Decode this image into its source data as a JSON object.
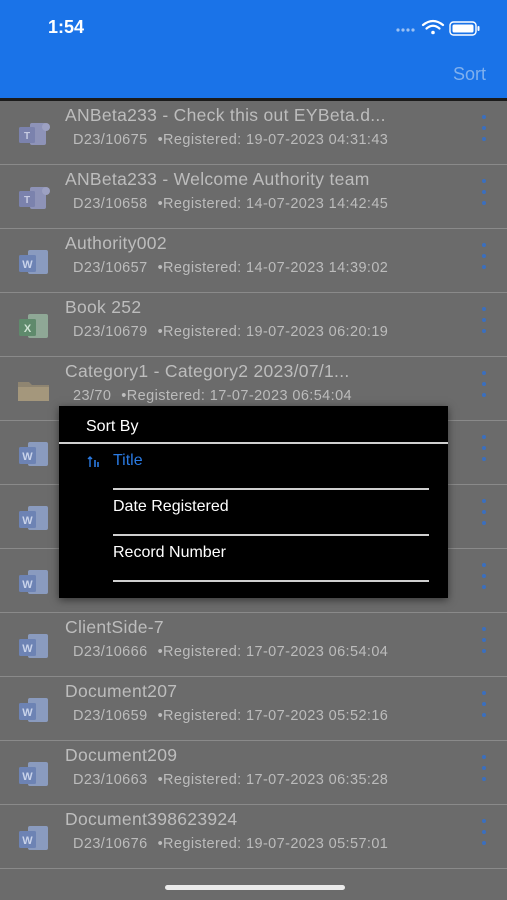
{
  "status": {
    "time": "1:54"
  },
  "nav": {
    "sort_label": "Sort"
  },
  "records": [
    {
      "title": "ANBeta233 - Check this out  EYBeta.d...",
      "number": "D23/10675",
      "registered": "•Registered:  19-07-2023 04:31:43",
      "icon": "teams-icon"
    },
    {
      "title": "ANBeta233 - Welcome Authority team",
      "number": "D23/10658",
      "registered": "•Registered:  14-07-2023 14:42:45",
      "icon": "teams-icon"
    },
    {
      "title": "Authority002",
      "number": "D23/10657",
      "registered": "•Registered:  14-07-2023 14:39:02",
      "icon": "word-icon"
    },
    {
      "title": "Book 252",
      "number": "D23/10679",
      "registered": "•Registered:  19-07-2023 06:20:19",
      "icon": "excel-icon"
    },
    {
      "title": "Category1 - Category2 2023/07/1...",
      "number": "23/70",
      "registered": "•Registered:  17-07-2023 06:54:04",
      "icon": "folder-icon"
    },
    {
      "title": "",
      "number": "",
      "registered": "",
      "icon": "word-icon"
    },
    {
      "title": "",
      "number": "",
      "registered": "",
      "icon": "word-icon"
    },
    {
      "title": "",
      "number": "",
      "registered": "",
      "icon": "word-icon"
    },
    {
      "title": "ClientSide-7",
      "number": "D23/10666",
      "registered": "•Registered:  17-07-2023 06:54:04",
      "icon": "word-icon"
    },
    {
      "title": "Document207",
      "number": "D23/10659",
      "registered": "•Registered:  17-07-2023 05:52:16",
      "icon": "word-icon"
    },
    {
      "title": "Document209",
      "number": "D23/10663",
      "registered": "•Registered:  17-07-2023 06:35:28",
      "icon": "word-icon"
    },
    {
      "title": "Document398623924",
      "number": "D23/10676",
      "registered": "•Registered:  19-07-2023 05:57:01",
      "icon": "word-icon"
    }
  ],
  "sort_menu": {
    "heading": "Sort By",
    "options": [
      {
        "label": "Title",
        "selected": true
      },
      {
        "label": "Date Registered",
        "selected": false
      },
      {
        "label": "Record Number",
        "selected": false
      }
    ]
  },
  "colors": {
    "accent": "#1a73e8",
    "selected": "#2a7ae2",
    "overlay_bg": "#6b6b6b"
  }
}
